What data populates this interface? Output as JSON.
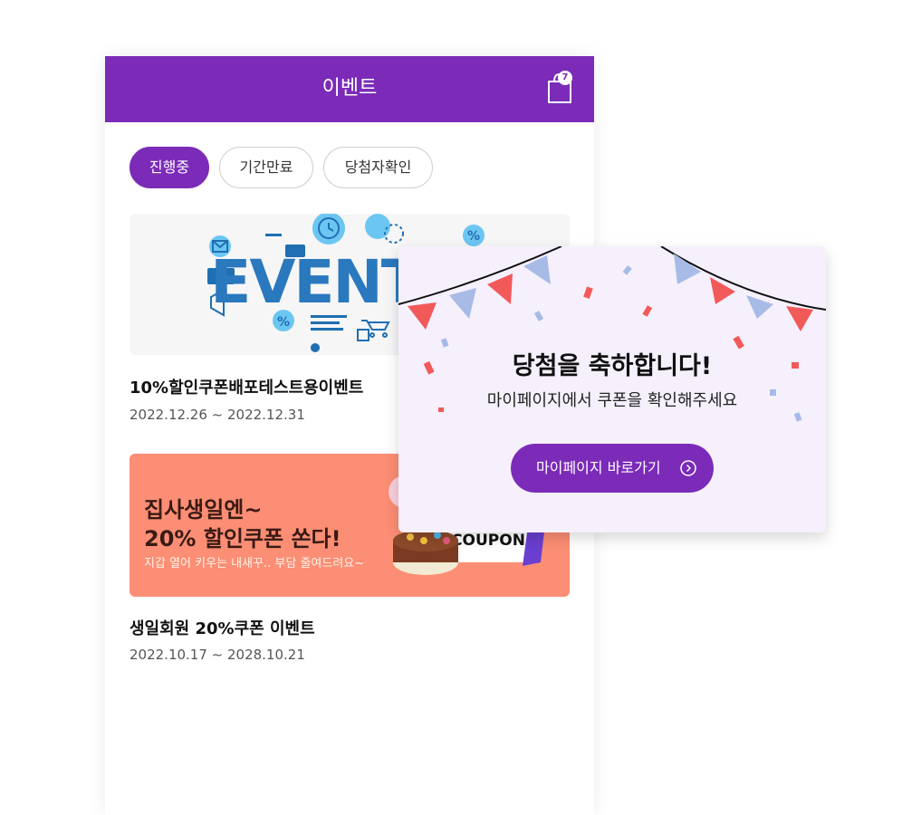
{
  "header": {
    "title": "이벤트",
    "cart_count": "7",
    "background_color": "#7b2bb8"
  },
  "tabs": [
    {
      "label": "진행중",
      "active": true
    },
    {
      "label": "기간만료",
      "active": false
    },
    {
      "label": "당첨자확인",
      "active": false
    }
  ],
  "events": [
    {
      "title": "10%할인쿠폰배포테스트용이벤트",
      "date": "2022.12.26 ~ 2022.12.31",
      "banner_text": "EVENT"
    },
    {
      "title": "생일회원 20%쿠폰 이벤트",
      "date": "2022.10.17 ~ 2028.10.21",
      "banner_line1": "집사생일엔~",
      "banner_line2": "20% 할인쿠폰 쏜다!",
      "banner_sub": "지갑 열어 키우는 내새꾸.. 부담 줄여드려요~",
      "banner_coupon": "COUPON"
    }
  ],
  "popup": {
    "title": "당첨을 축하합니다!",
    "message": "마이페이지에서 쿠폰을 확인해주세요",
    "button_label": "마이페이지 바로가기"
  },
  "icons": {
    "cart": "shopping-bag-icon",
    "popup_button": "chevron-right-circle-icon"
  }
}
